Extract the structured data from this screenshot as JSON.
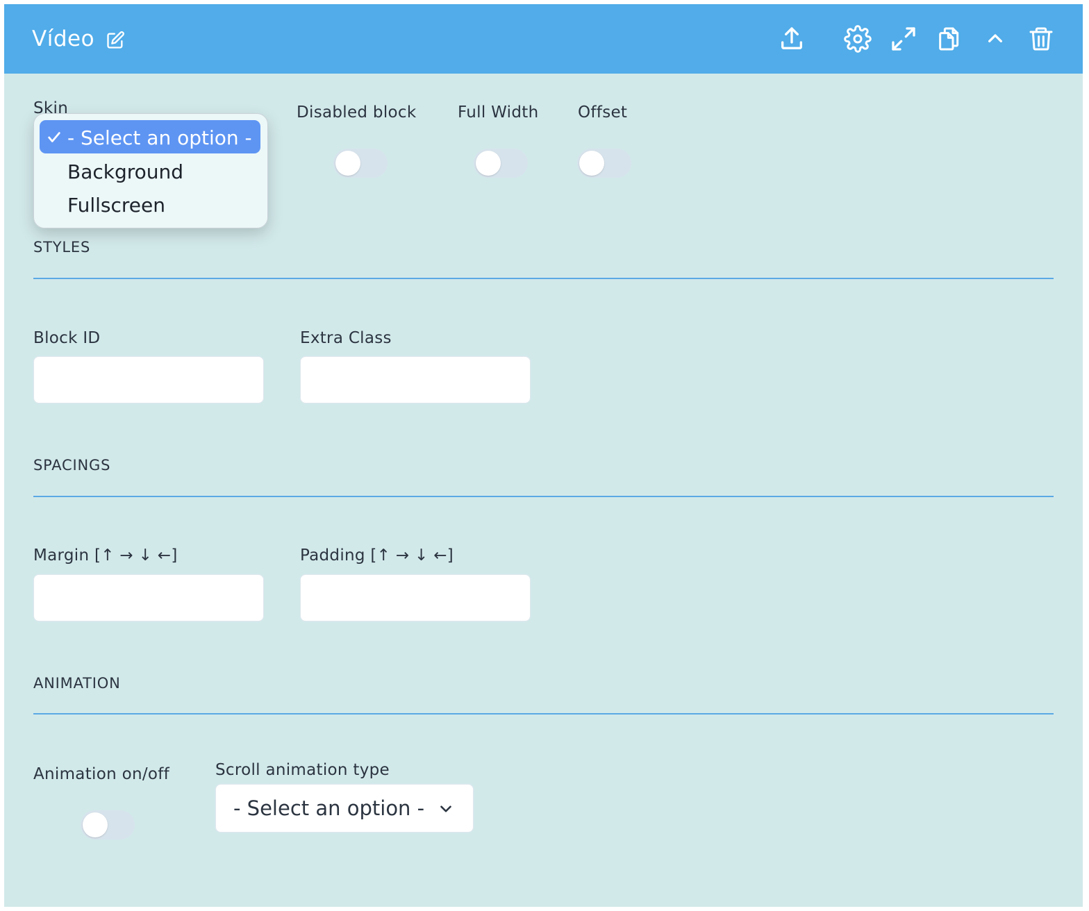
{
  "header": {
    "title": "Vídeo",
    "icons": [
      "edit-icon",
      "upload-icon",
      "gear-icon",
      "expand-icon",
      "copy-icon",
      "chevron-up-icon",
      "trash-icon"
    ],
    "color": "#51ace9"
  },
  "form": {
    "skin": {
      "label": "Skin",
      "options": [
        "- Select an option -",
        "Background",
        "Fullscreen"
      ],
      "selected": "- Select an option -"
    },
    "toggles": {
      "disabled_block": {
        "label": "Disabled block",
        "on": false
      },
      "full_width": {
        "label": "Full Width",
        "on": false
      },
      "offset": {
        "label": "Offset",
        "on": false
      }
    },
    "styles": {
      "heading": "STYLES",
      "block_id": {
        "label": "Block ID",
        "value": ""
      },
      "extra_class": {
        "label": "Extra Class",
        "value": ""
      }
    },
    "spacings": {
      "heading": "SPACINGS",
      "margin": {
        "label": "Margin [↑ → ↓ ←]",
        "value": ""
      },
      "padding": {
        "label": "Padding [↑ → ↓ ←]",
        "value": ""
      }
    },
    "animation": {
      "heading": "ANIMATION",
      "toggle": {
        "label": "Animation on/off",
        "on": false
      },
      "scroll_type": {
        "label": "Scroll animation type",
        "value": "- Select an option -"
      }
    }
  },
  "colors": {
    "panel_bg": "#d2e9ea",
    "rule": "#5aa9e4",
    "selected_option": "#5e95f3"
  }
}
